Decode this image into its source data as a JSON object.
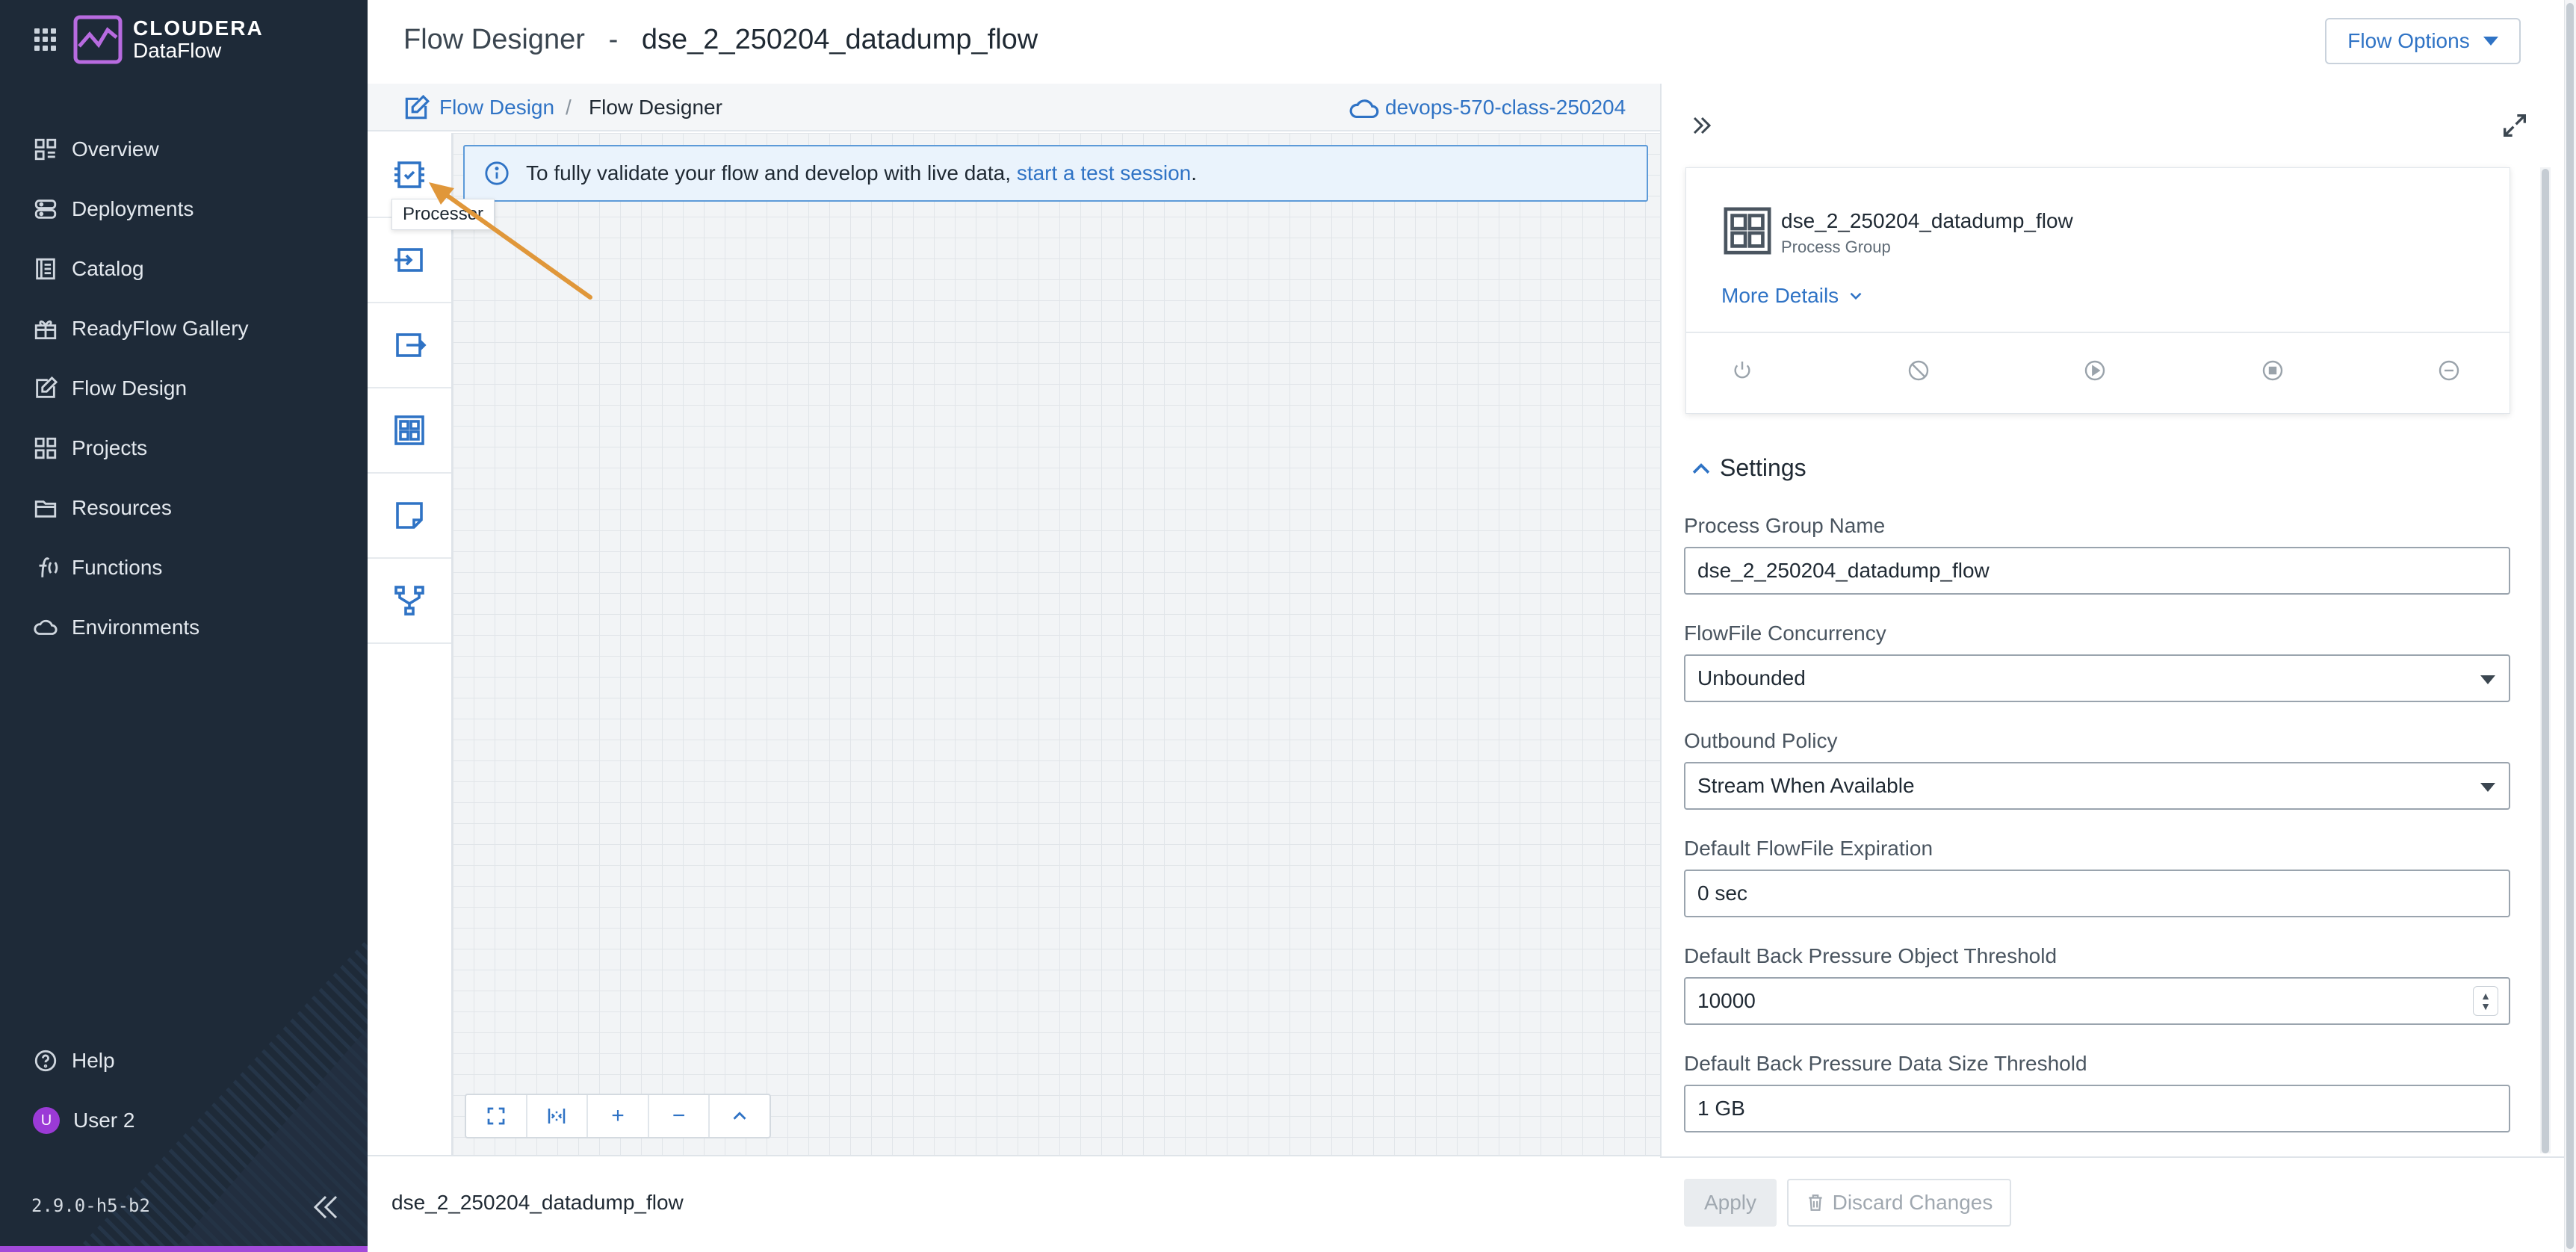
{
  "app": {
    "brand_top": "CLOUDERA",
    "brand_bottom": "DataFlow",
    "version": "2.9.0-h5-b2",
    "accent": "#a24ad9"
  },
  "sidebar": {
    "items": [
      {
        "label": "Overview",
        "icon": "overview-icon"
      },
      {
        "label": "Deployments",
        "icon": "deployments-icon"
      },
      {
        "label": "Catalog",
        "icon": "catalog-icon"
      },
      {
        "label": "ReadyFlow Gallery",
        "icon": "gift-icon"
      },
      {
        "label": "Flow Design",
        "icon": "edit-icon"
      },
      {
        "label": "Projects",
        "icon": "grid-icon"
      },
      {
        "label": "Resources",
        "icon": "folder-icon"
      },
      {
        "label": "Functions",
        "icon": "function-icon"
      },
      {
        "label": "Environments",
        "icon": "cloud-icon"
      }
    ],
    "help": "Help",
    "user": {
      "initial": "U",
      "name": "User 2"
    }
  },
  "header": {
    "title": "Flow Designer",
    "separator": "-",
    "flow_name": "dse_2_250204_datadump_flow",
    "flow_options": "Flow Options"
  },
  "breadcrumb": {
    "link": "Flow Design",
    "sep": "/",
    "current": "Flow Designer",
    "environment": "devops-570-class-250204"
  },
  "palette": {
    "tooltip": "Processor",
    "tools": [
      "processor-icon",
      "input-port-icon",
      "output-port-icon",
      "process-group-icon",
      "label-icon",
      "funnel-icon"
    ]
  },
  "banner": {
    "text": "To fully validate your flow and develop with live data, ",
    "link": "start a test session",
    "end": "."
  },
  "zoom": {
    "fit": "fit-icon",
    "actual": "actual-size-icon",
    "in": "+",
    "out": "−",
    "up": "chevron-up-icon"
  },
  "status": {
    "name": "dse_2_250204_datadump_flow"
  },
  "panel": {
    "card": {
      "name": "dse_2_250204_datadump_flow",
      "type": "Process Group",
      "more": "More Details"
    },
    "settings_title": "Settings",
    "fields": {
      "pg_name_label": "Process Group Name",
      "pg_name_value": "dse_2_250204_datadump_flow",
      "concurrency_label": "FlowFile Concurrency",
      "concurrency_value": "Unbounded",
      "outbound_label": "Outbound Policy",
      "outbound_value": "Stream When Available",
      "expiration_label": "Default FlowFile Expiration",
      "expiration_value": "0 sec",
      "bp_object_label": "Default Back Pressure Object Threshold",
      "bp_object_value": "10000",
      "bp_size_label": "Default Back Pressure Data Size Threshold",
      "bp_size_value": "1 GB"
    },
    "apply": "Apply",
    "discard": "Discard Changes"
  }
}
